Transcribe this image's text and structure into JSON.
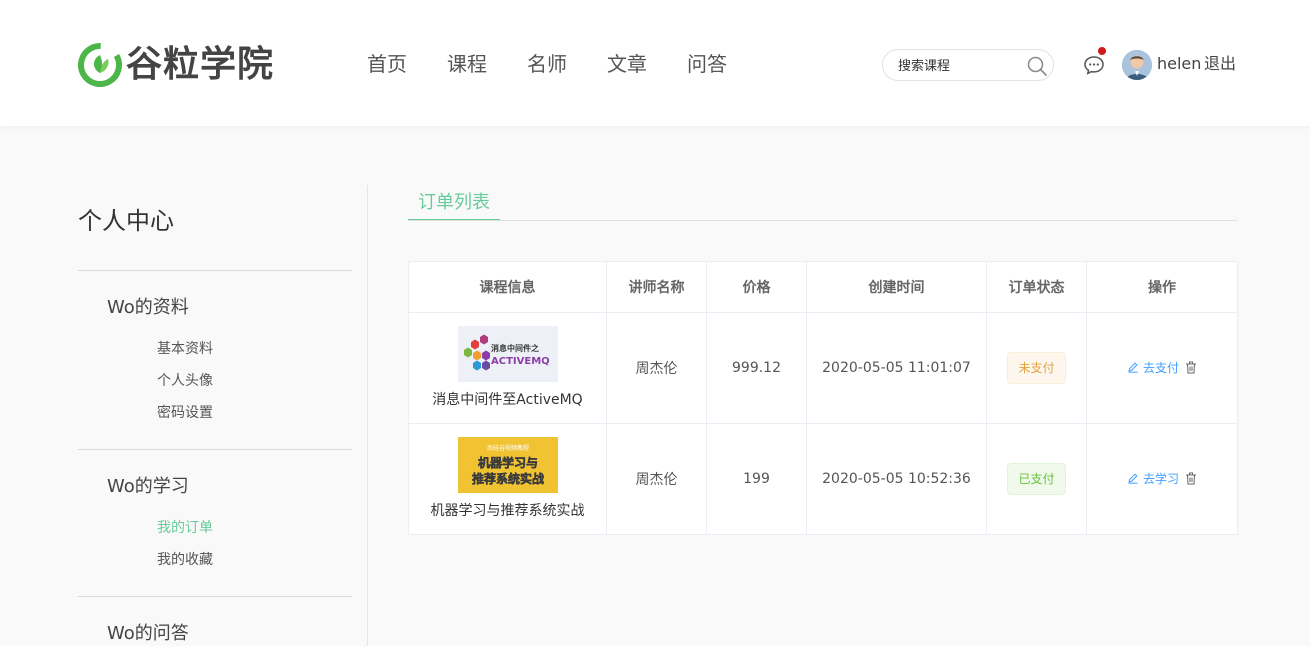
{
  "header": {
    "logo_text": "谷粒学院",
    "nav": [
      "首页",
      "课程",
      "名师",
      "文章",
      "问答"
    ],
    "search_placeholder": "搜索课程",
    "username": "helen",
    "logout": "退出"
  },
  "sidebar": {
    "title": "个人中心",
    "sections": [
      {
        "title": "Wo的资料",
        "links": [
          "基本资料",
          "个人头像",
          "密码设置"
        ]
      },
      {
        "title": "Wo的学习",
        "links": [
          "我的订单",
          "我的收藏"
        ]
      },
      {
        "title": "Wo的问答",
        "links": []
      }
    ],
    "active_link": "我的订单"
  },
  "main": {
    "tab": "订单列表",
    "columns": [
      "课程信息",
      "讲师名称",
      "价格",
      "创建时间",
      "订单状态",
      "操作"
    ],
    "rows": [
      {
        "thumb_text": [
          "消息中间件之",
          "ACTIVEMQ"
        ],
        "course": "消息中间件至ActiveMQ",
        "teacher": "周杰伦",
        "price": "999.12",
        "created": "2020-05-05 11:01:07",
        "status": "未支付",
        "action": "去支付"
      },
      {
        "thumb_text": [
          "尚硅谷视频教程",
          "机器学习与",
          "推荐系统实战"
        ],
        "course": "机器学习与推荐系统实战",
        "teacher": "周杰伦",
        "price": "199",
        "created": "2020-05-05 10:52:36",
        "status": "已支付",
        "action": "去学习"
      }
    ]
  },
  "colors": {
    "accent": "#68cb9b",
    "link": "#409eff",
    "unpaid": "#e6a23c",
    "paid": "#67c23a",
    "notification_dot": "#d0191a"
  }
}
